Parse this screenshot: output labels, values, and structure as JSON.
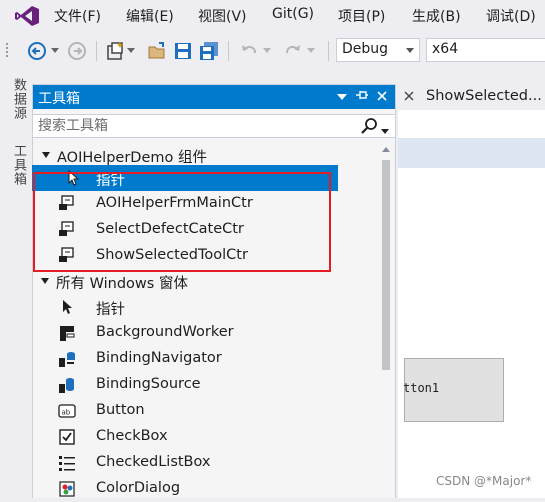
{
  "menu": {
    "items": [
      "文件(F)",
      "编辑(E)",
      "视图(V)",
      "Git(G)",
      "项目(P)",
      "生成(B)",
      "调试(D)"
    ]
  },
  "toolbar": {
    "config": "Debug",
    "platform": "x64"
  },
  "side_tabs": [
    "数据源",
    "工具箱"
  ],
  "toolbox": {
    "title": "工具箱",
    "search_placeholder": "搜索工具箱",
    "groups": [
      {
        "header": "AOIHelperDemo 组件",
        "items": [
          {
            "label": "指针",
            "icon": "pointer-icon",
            "selected": true
          },
          {
            "label": "AOIHelperFrmMainCtr",
            "icon": "user-control-icon"
          },
          {
            "label": "SelectDefectCateCtr",
            "icon": "user-control-icon"
          },
          {
            "label": "ShowSelectedToolCtr",
            "icon": "user-control-icon"
          }
        ]
      },
      {
        "header": "所有 Windows 窗体",
        "items": [
          {
            "label": "指针",
            "icon": "pointer-icon"
          },
          {
            "label": "BackgroundWorker",
            "icon": "background-worker-icon"
          },
          {
            "label": "BindingNavigator",
            "icon": "binding-navigator-icon"
          },
          {
            "label": "BindingSource",
            "icon": "binding-source-icon"
          },
          {
            "label": "Button",
            "icon": "button-icon"
          },
          {
            "label": "CheckBox",
            "icon": "checkbox-icon"
          },
          {
            "label": "CheckedListBox",
            "icon": "checked-listbox-icon"
          },
          {
            "label": "ColorDialog",
            "icon": "color-dialog-icon"
          }
        ]
      }
    ]
  },
  "designer": {
    "tab_title": "ShowSelected...",
    "button_text": "tton1"
  },
  "watermark": "CSDN @*Major*",
  "colors": {
    "accent": "#007acc",
    "highlight_box": "#e51c24",
    "chrome": "#eeeef2"
  }
}
